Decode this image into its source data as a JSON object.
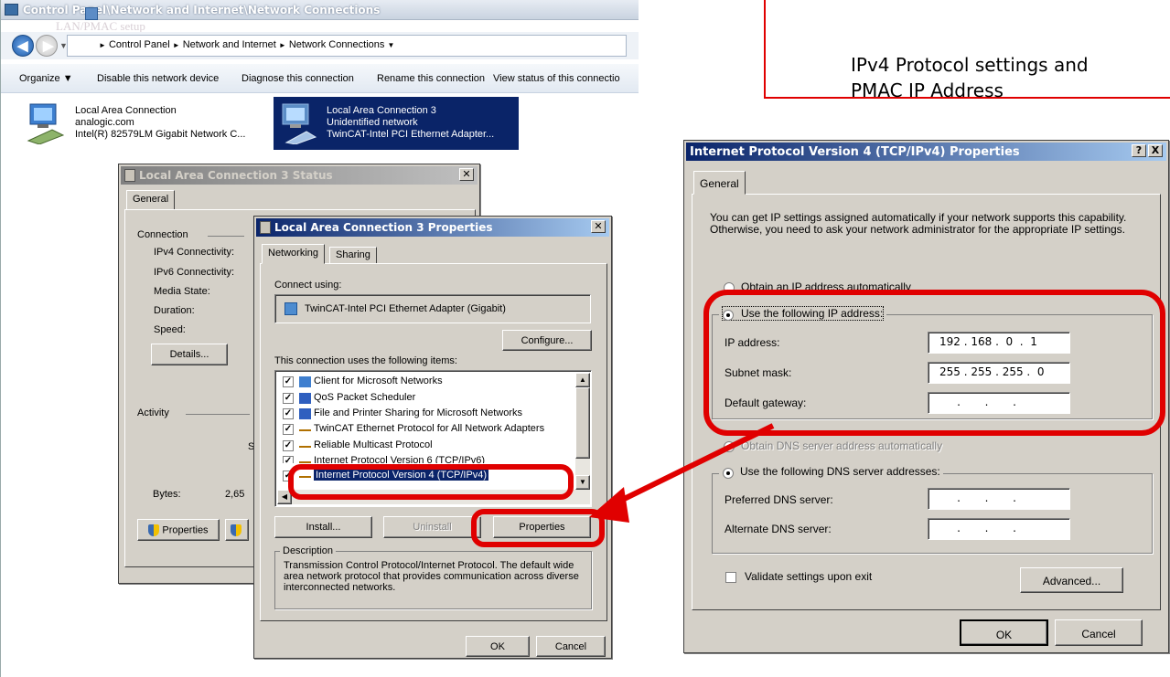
{
  "explorer": {
    "title": "Control Panel\\Network and Internet\\Network Connections",
    "faded_text": "LAN/PMAC setup",
    "breadcrumbs": [
      "Control Panel",
      "Network and Internet",
      "Network Connections"
    ],
    "toolbar": [
      "Organize",
      "Disable this network device",
      "Diagnose this connection",
      "Rename this connection",
      "View status of this connectio"
    ],
    "connections": [
      {
        "name": "Local Area Connection",
        "status": "analogic.com",
        "adapter": "Intel(R) 82579LM Gigabit Network C..."
      },
      {
        "name": "Local Area Connection 3",
        "status": "Unidentified network",
        "adapter": "TwinCAT-Intel PCI Ethernet Adapter..."
      }
    ]
  },
  "status_dialog": {
    "title": "Local Area Connection 3 Status",
    "tab": "General",
    "connection_group": "Connection",
    "rows": [
      {
        "label": "IPv4 Connectivity:"
      },
      {
        "label": "IPv6 Connectivity:"
      },
      {
        "label": "Media State:"
      },
      {
        "label": "Duration:"
      },
      {
        "label": "Speed:"
      }
    ],
    "details_button": "Details...",
    "activity_group": "Activity",
    "activity_partial": "S",
    "bytes_label": "Bytes:",
    "bytes_value": "2,65",
    "properties_button": "Properties"
  },
  "properties_dialog": {
    "title": "Local Area Connection 3 Properties",
    "tabs": [
      "Networking",
      "Sharing"
    ],
    "connect_using_label": "Connect using:",
    "adapter": "TwinCAT-Intel PCI Ethernet Adapter (Gigabit)",
    "configure_button": "Configure...",
    "items_label": "This connection uses the following items:",
    "items": [
      {
        "label": "Client for Microsoft Networks",
        "checked": true,
        "icon": "network-client-icon"
      },
      {
        "label": "QoS Packet Scheduler",
        "checked": true,
        "icon": "scheduler-icon"
      },
      {
        "label": "File and Printer Sharing for Microsoft Networks",
        "checked": true,
        "icon": "file-sharing-icon"
      },
      {
        "label": "TwinCAT Ethernet Protocol for All Network Adapters",
        "checked": true,
        "icon": "protocol-icon"
      },
      {
        "label": "Reliable Multicast Protocol",
        "checked": true,
        "icon": "protocol-icon"
      },
      {
        "label": "Internet Protocol Version 6 (TCP/IPv6)",
        "checked": true,
        "icon": "protocol-icon"
      },
      {
        "label": "Internet Protocol Version 4 (TCP/IPv4)",
        "checked": true,
        "icon": "protocol-icon",
        "selected": true
      }
    ],
    "install_button": "Install...",
    "uninstall_button": "Uninstall",
    "properties_button": "Properties",
    "description_group": "Description",
    "description": "Transmission Control Protocol/Internet Protocol. The default wide area network protocol that provides communication across diverse interconnected networks.",
    "ok_button": "OK",
    "cancel_button": "Cancel"
  },
  "ipv4_dialog": {
    "title": "Internet Protocol Version 4 (TCP/IPv4) Properties",
    "help_button": "?",
    "close_button": "X",
    "tab": "General",
    "intro": "You can get IP settings assigned automatically if your network supports this capability. Otherwise, you need to ask your network administrator for the appropriate IP settings.",
    "obtain_auto_ip": "Obtain an IP address automatically",
    "use_following_ip": "Use the following IP address:",
    "ip_address_label": "IP address:",
    "ip_address_value": "192 . 168 .  0  .  1",
    "subnet_label": "Subnet mask:",
    "subnet_value": "255 . 255 . 255 .  0",
    "gateway_label": "Default gateway:",
    "gateway_value": "     .       .       .",
    "obtain_auto_dns": "Obtain DNS server address automatically",
    "use_following_dns": "Use the following DNS server addresses:",
    "preferred_dns_label": "Preferred DNS server:",
    "preferred_dns_value": "     .       .       .",
    "alternate_dns_label": "Alternate DNS server:",
    "alternate_dns_value": "     .       .       .",
    "validate_label": "Validate settings upon exit",
    "advanced_button": "Advanced...",
    "ok_button": "OK",
    "cancel_button": "Cancel"
  },
  "annotation": {
    "note": "IPv4 Protocol settings and PMAC IP Address",
    "color": "#e00000"
  }
}
